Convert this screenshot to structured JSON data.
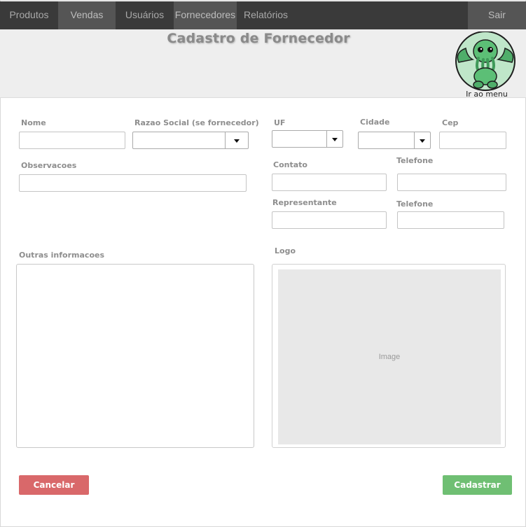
{
  "nav": {
    "items": [
      {
        "label": "Produtos"
      },
      {
        "label": "Vendas"
      },
      {
        "label": "Usuários"
      },
      {
        "label": "Fornecedores"
      },
      {
        "label": "Relatórios"
      }
    ],
    "logout_label": "Sair"
  },
  "header": {
    "title": "Cadastro de Fornecedor",
    "menu_link": "Ir ao menu",
    "logo_icon": "cthulhu-mascot-icon"
  },
  "form": {
    "nome_label": "Nome",
    "razao_label": "Razao Social (se fornecedor)",
    "uf_label": "UF",
    "cidade_label": "Cidade",
    "cep_label": "Cep",
    "observacoes_label": "Observacoes",
    "contato_label": "Contato",
    "telefone1_label": "Telefone",
    "representante_label": "Representante",
    "telefone2_label": "Telefone",
    "outras_label": "Outras informacoes",
    "logo_label": "Logo",
    "image_placeholder": "Image"
  },
  "actions": {
    "cancel_label": "Cancelar",
    "submit_label": "Cadastrar"
  },
  "colors": {
    "nav_bg": "#3a3a3a",
    "cancel": "#d9686a",
    "submit": "#6fbf73"
  }
}
